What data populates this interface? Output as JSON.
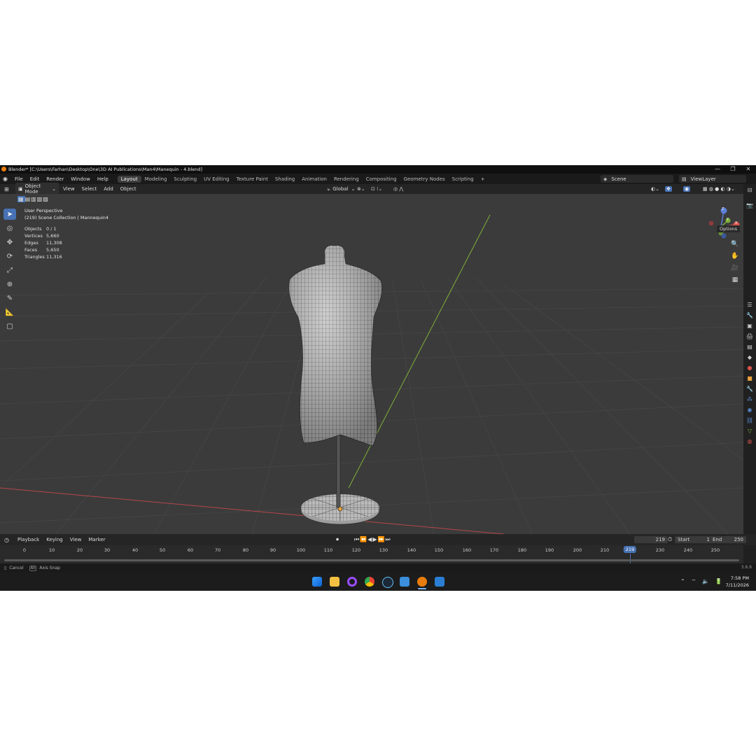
{
  "window": {
    "title": "Blender* [C:\\Users\\Farhan\\Desktop\\One\\3D AI Publications\\Man4\\Manequin - 4.blend]",
    "controls": [
      "—",
      "❐",
      "✕"
    ]
  },
  "menu": {
    "items": [
      "File",
      "Edit",
      "Render",
      "Window",
      "Help"
    ],
    "workspaces": [
      "Layout",
      "Modeling",
      "Sculpting",
      "UV Editing",
      "Texture Paint",
      "Shading",
      "Animation",
      "Rendering",
      "Compositing",
      "Geometry Nodes",
      "Scripting"
    ],
    "add_tab": "+",
    "scene": "Scene",
    "view_layer": "ViewLayer"
  },
  "viewport_header": {
    "mode": "Object Mode",
    "items": [
      "View",
      "Select",
      "Add",
      "Object"
    ],
    "transform_orientation": "Global",
    "options": "Options"
  },
  "viewport": {
    "perspective": "User Perspective",
    "collection": "(219) Scene Collection | Mannequin4",
    "stats": [
      {
        "label": "Objects",
        "value": "0 / 1"
      },
      {
        "label": "Vertices",
        "value": "5,660"
      },
      {
        "label": "Edges",
        "value": "11,308"
      },
      {
        "label": "Faces",
        "value": "5,650"
      },
      {
        "label": "Triangles",
        "value": "11,316"
      }
    ],
    "gizmo": {
      "x": "X",
      "y": "Y",
      "z": "Z"
    }
  },
  "timeline": {
    "items": [
      "Playback",
      "Keying",
      "View",
      "Marker"
    ],
    "current_frame": "219",
    "start_label": "Start",
    "start": "1",
    "end_label": "End",
    "end": "250",
    "ticks": [
      "0",
      "10",
      "20",
      "30",
      "40",
      "50",
      "60",
      "70",
      "80",
      "90",
      "100",
      "110",
      "120",
      "130",
      "140",
      "150",
      "160",
      "170",
      "180",
      "190",
      "200",
      "210",
      "230",
      "240",
      "250"
    ]
  },
  "statusbar": {
    "cancel": "Cancel",
    "alt_key": "Alt",
    "axis_snap": "Axis Snap",
    "version": "3.6.9"
  },
  "taskbar": {
    "time": "7:58 PM",
    "date": "7/11/2026"
  },
  "colors": {
    "accent": "#4772b3",
    "x_axis": "#c0392b",
    "y_axis": "#7fb03a",
    "viewport_bg": "#3b3b3b"
  }
}
